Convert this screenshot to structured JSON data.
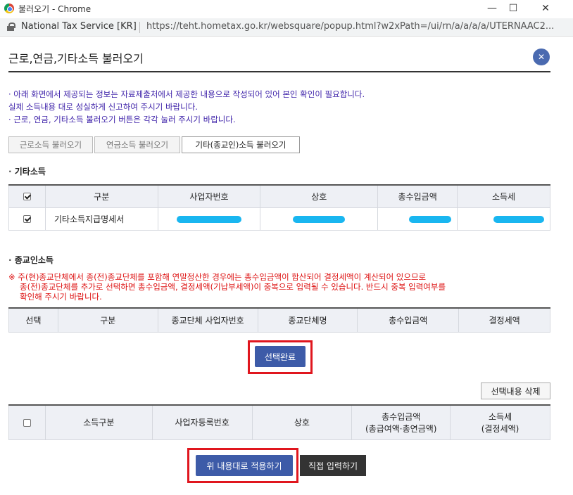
{
  "window": {
    "title": "불러오기 - Chrome",
    "controls": {
      "minimize": "—",
      "maximize": "☐",
      "close": "✕"
    }
  },
  "address_bar": {
    "site_name": "National Tax Service [KR]",
    "url": "https://teht.hometax.go.kr/websquare/popup.html?w2xPath=/ui/rn/a/a/a/a/UTERNAAC2..."
  },
  "popup": {
    "title": "근로,연금,기타소득 불러오기",
    "close_glyph": "✕"
  },
  "notices": [
    "· 아래 화면에서 제공되는 정보는 자료제출처에서 제공한 내용으로 작성되어 있어 본인 확인이 필요합니다.",
    "  실제 소득내용 대로 성실하게 신고하여 주시기 바랍니다.",
    "· 근로, 연금, 기타소득 불러오기 버튼은 각각 눌러 주시기 바랍니다."
  ],
  "tabs": [
    {
      "label": "근로소득 불러오기",
      "active": false
    },
    {
      "label": "연금소득 불러오기",
      "active": false
    },
    {
      "label": "기타(종교인)소득 불러오기",
      "active": true
    }
  ],
  "other_income": {
    "section_title": "기타소득",
    "headers": [
      "구분",
      "사업자번호",
      "상호",
      "총수입금액",
      "소득세"
    ],
    "rows": [
      {
        "checked": true,
        "category": "기타소득지급명세서"
      }
    ]
  },
  "religious_income": {
    "section_title": "종교인소득",
    "warning": [
      "※ 주(현)종교단체에서 종(전)종교단체를 포함해 연말정산한 경우에는 총수입금액이 합산되어 결정세액이 계산되어 있으므로",
      "종(전)종교단체를 추가로 선택하면 총수입금액, 결정세액(기납부세액)이 중복으로 입력될 수 있습니다. 반드시 중복 입력여부를",
      "확인해 주시기 바랍니다."
    ],
    "headers": [
      "선택",
      "구분",
      "종교단체 사업자번호",
      "종교단체명",
      "총수입금액",
      "결정세액"
    ],
    "select_done_label": "선택완료"
  },
  "selection": {
    "delete_label": "선택내용 삭제",
    "headers": [
      "소득구분",
      "사업자등록번호",
      "상호",
      "총수입금액",
      "(총급여액·총연금액)",
      "소득세",
      "(결정세액)"
    ]
  },
  "footer": {
    "apply_label": "위 내용대로 적용하기",
    "manual_label": "직접 입력하기"
  },
  "colors": {
    "primary_button": "#3d5ba8",
    "highlight": "#e0161e",
    "notice_text": "#3b1fa8",
    "warning_text": "#d11111",
    "redaction": "#19b6f0"
  }
}
